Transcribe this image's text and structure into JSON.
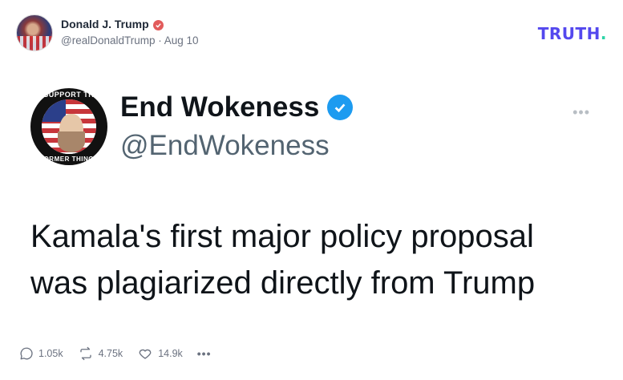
{
  "post": {
    "author_name": "Donald J. Trump",
    "handle": "@realDonaldTrump",
    "separator": "·",
    "date": "Aug 10",
    "platform_logo": "TRUTH",
    "platform_logo_dot": ".",
    "verified_color": "#e25b5b"
  },
  "embedded_tweet": {
    "name": "End Wokeness",
    "handle": "@EndWokeness",
    "avatar_ring_top": "I SUPPORT THE",
    "avatar_ring_bottom": "FORMER THINGS",
    "text": "Kamala's first major policy proposal was plagiarized directly from Trump",
    "more_icon": "ellipsis-icon",
    "verified_color": "#1d9bf0"
  },
  "actions": {
    "replies": "1.05k",
    "retruths": "4.75k",
    "likes": "14.9k",
    "more": "•••"
  },
  "colors": {
    "brand": "#5448ee",
    "brand_dot": "#2bd4a6"
  }
}
